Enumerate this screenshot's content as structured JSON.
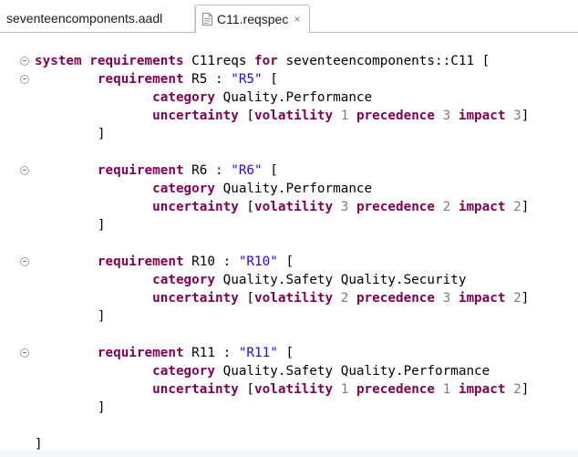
{
  "tabs": [
    {
      "label": "seventeencomponents.aadl",
      "active": false
    },
    {
      "label": "C11.reqspec",
      "active": true,
      "close_glyph": "×",
      "icon": "reqspec-file-icon"
    }
  ],
  "editor": {
    "lines": [
      [
        {
          "t": "system",
          "c": "kw"
        },
        {
          "t": " ",
          "c": "plain"
        },
        {
          "t": "requirements",
          "c": "kw"
        },
        {
          "t": " C11reqs ",
          "c": "plain"
        },
        {
          "t": "for",
          "c": "kw"
        },
        {
          "t": " seventeencomponents::C11 [",
          "c": "plain"
        }
      ],
      [
        {
          "t": "        ",
          "c": "plain"
        },
        {
          "t": "requirement",
          "c": "kw"
        },
        {
          "t": " R5 : ",
          "c": "plain"
        },
        {
          "t": "\"R5\"",
          "c": "str"
        },
        {
          "t": " [",
          "c": "plain"
        }
      ],
      [
        {
          "t": "               ",
          "c": "plain"
        },
        {
          "t": "category",
          "c": "kw"
        },
        {
          "t": " Quality.Performance",
          "c": "plain"
        }
      ],
      [
        {
          "t": "               ",
          "c": "plain"
        },
        {
          "t": "uncertainty",
          "c": "kw"
        },
        {
          "t": " [",
          "c": "plain"
        },
        {
          "t": "volatility",
          "c": "kw"
        },
        {
          "t": " ",
          "c": "plain"
        },
        {
          "t": "1",
          "c": "num"
        },
        {
          "t": " ",
          "c": "plain"
        },
        {
          "t": "precedence",
          "c": "kw"
        },
        {
          "t": " ",
          "c": "plain"
        },
        {
          "t": "3",
          "c": "num"
        },
        {
          "t": " ",
          "c": "plain"
        },
        {
          "t": "impact",
          "c": "kw"
        },
        {
          "t": " ",
          "c": "plain"
        },
        {
          "t": "3",
          "c": "num"
        },
        {
          "t": "]",
          "c": "plain"
        }
      ],
      [
        {
          "t": "        ]",
          "c": "plain"
        }
      ],
      [],
      [
        {
          "t": "        ",
          "c": "plain"
        },
        {
          "t": "requirement",
          "c": "kw"
        },
        {
          "t": " R6 : ",
          "c": "plain"
        },
        {
          "t": "\"R6\"",
          "c": "str"
        },
        {
          "t": " [",
          "c": "plain"
        }
      ],
      [
        {
          "t": "               ",
          "c": "plain"
        },
        {
          "t": "category",
          "c": "kw"
        },
        {
          "t": " Quality.Performance",
          "c": "plain"
        }
      ],
      [
        {
          "t": "               ",
          "c": "plain"
        },
        {
          "t": "uncertainty",
          "c": "kw"
        },
        {
          "t": " [",
          "c": "plain"
        },
        {
          "t": "volatility",
          "c": "kw"
        },
        {
          "t": " ",
          "c": "plain"
        },
        {
          "t": "3",
          "c": "num"
        },
        {
          "t": " ",
          "c": "plain"
        },
        {
          "t": "precedence",
          "c": "kw"
        },
        {
          "t": " ",
          "c": "plain"
        },
        {
          "t": "2",
          "c": "num"
        },
        {
          "t": " ",
          "c": "plain"
        },
        {
          "t": "impact",
          "c": "kw"
        },
        {
          "t": " ",
          "c": "plain"
        },
        {
          "t": "2",
          "c": "num"
        },
        {
          "t": "]",
          "c": "plain"
        }
      ],
      [
        {
          "t": "        ]",
          "c": "plain"
        }
      ],
      [],
      [
        {
          "t": "        ",
          "c": "plain"
        },
        {
          "t": "requirement",
          "c": "kw"
        },
        {
          "t": " R10 : ",
          "c": "plain"
        },
        {
          "t": "\"R10\"",
          "c": "str"
        },
        {
          "t": " [",
          "c": "plain"
        }
      ],
      [
        {
          "t": "               ",
          "c": "plain"
        },
        {
          "t": "category",
          "c": "kw"
        },
        {
          "t": " Quality.Safety Quality.Security",
          "c": "plain"
        }
      ],
      [
        {
          "t": "               ",
          "c": "plain"
        },
        {
          "t": "uncertainty",
          "c": "kw"
        },
        {
          "t": " [",
          "c": "plain"
        },
        {
          "t": "volatility",
          "c": "kw"
        },
        {
          "t": " ",
          "c": "plain"
        },
        {
          "t": "2",
          "c": "num"
        },
        {
          "t": " ",
          "c": "plain"
        },
        {
          "t": "precedence",
          "c": "kw"
        },
        {
          "t": " ",
          "c": "plain"
        },
        {
          "t": "3",
          "c": "num"
        },
        {
          "t": " ",
          "c": "plain"
        },
        {
          "t": "impact",
          "c": "kw"
        },
        {
          "t": " ",
          "c": "plain"
        },
        {
          "t": "2",
          "c": "num"
        },
        {
          "t": "]",
          "c": "plain"
        }
      ],
      [
        {
          "t": "        ]",
          "c": "plain"
        }
      ],
      [],
      [
        {
          "t": "        ",
          "c": "plain"
        },
        {
          "t": "requirement",
          "c": "kw"
        },
        {
          "t": " R11 : ",
          "c": "plain"
        },
        {
          "t": "\"R11\"",
          "c": "str"
        },
        {
          "t": " [",
          "c": "plain"
        }
      ],
      [
        {
          "t": "               ",
          "c": "plain"
        },
        {
          "t": "category",
          "c": "kw"
        },
        {
          "t": " Quality.Safety Quality.Performance",
          "c": "plain"
        }
      ],
      [
        {
          "t": "               ",
          "c": "plain"
        },
        {
          "t": "uncertainty",
          "c": "kw"
        },
        {
          "t": " [",
          "c": "plain"
        },
        {
          "t": "volatility",
          "c": "kw"
        },
        {
          "t": " ",
          "c": "plain"
        },
        {
          "t": "1",
          "c": "num"
        },
        {
          "t": " ",
          "c": "plain"
        },
        {
          "t": "precedence",
          "c": "kw"
        },
        {
          "t": " ",
          "c": "plain"
        },
        {
          "t": "1",
          "c": "num"
        },
        {
          "t": " ",
          "c": "plain"
        },
        {
          "t": "impact",
          "c": "kw"
        },
        {
          "t": " ",
          "c": "plain"
        },
        {
          "t": "2",
          "c": "num"
        },
        {
          "t": "]",
          "c": "plain"
        }
      ],
      [
        {
          "t": "        ]",
          "c": "plain"
        }
      ],
      [],
      [
        {
          "t": "]",
          "c": "plain"
        }
      ]
    ],
    "fold_lines": [
      1,
      2,
      7,
      12,
      17
    ],
    "colors": {
      "keyword": "#7f0055",
      "string": "#2a00ff",
      "number": "#7d7d7d",
      "text": "#000000"
    }
  }
}
